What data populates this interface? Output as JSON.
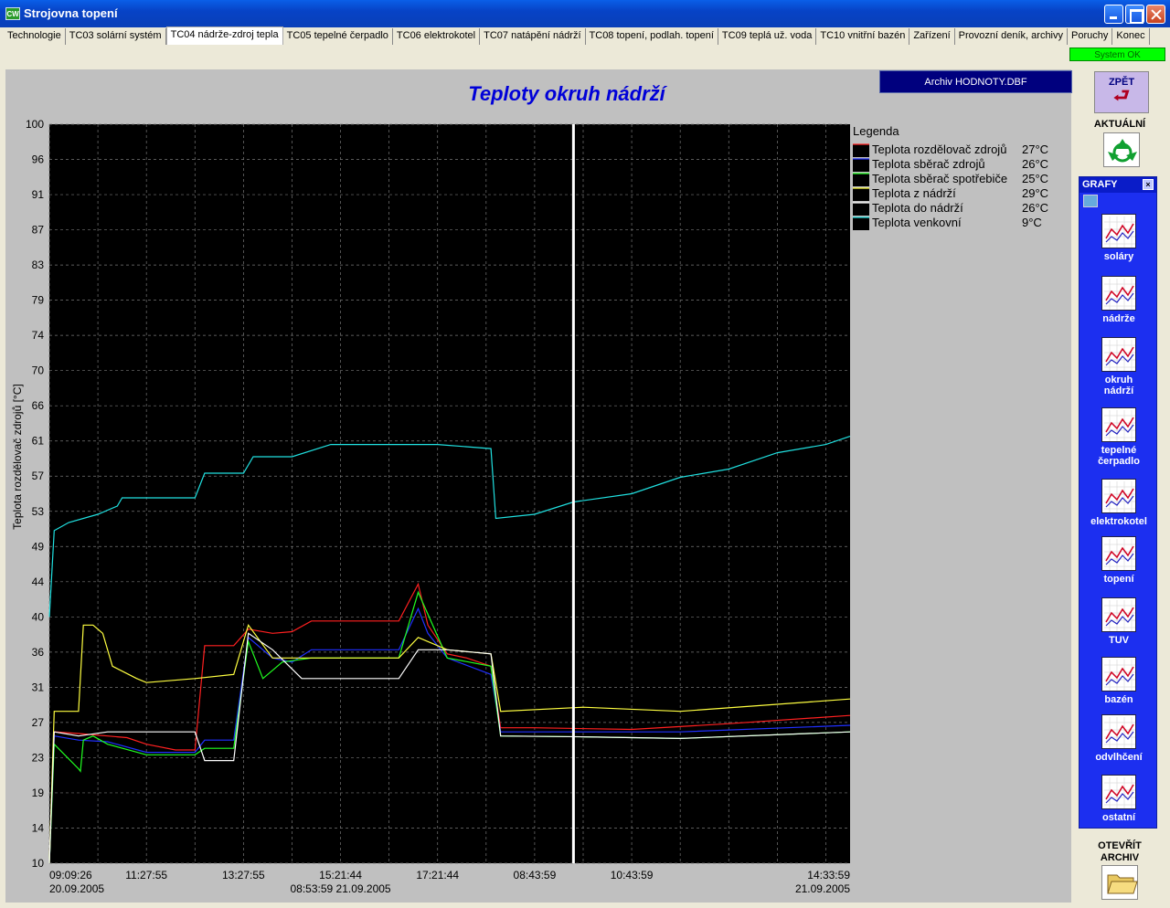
{
  "window": {
    "title": "Strojovna topení",
    "app_icon_text": "CW"
  },
  "tabs": [
    {
      "label": "Technologie",
      "active": false
    },
    {
      "label": "TC03 solární systém",
      "active": false
    },
    {
      "label": "TC04 nádrže-zdroj tepla",
      "active": true
    },
    {
      "label": "TC05 tepelné čerpadlo",
      "active": false
    },
    {
      "label": "TC06 elektrokotel",
      "active": false
    },
    {
      "label": "TC07 natápění nádrží",
      "active": false
    },
    {
      "label": "TC08 topení, podlah. topení",
      "active": false
    },
    {
      "label": "TC09 teplá už. voda",
      "active": false
    },
    {
      "label": "TC10 vnitřní bazén",
      "active": false
    },
    {
      "label": "Zařízení",
      "active": false
    },
    {
      "label": "Provozní deník, archivy",
      "active": false
    },
    {
      "label": "Poruchy",
      "active": false
    },
    {
      "label": "Konec",
      "active": false
    }
  ],
  "status": "System OK",
  "archive_label": "Archiv HODNOTY.DBF",
  "back_button": {
    "label": "ZPĚT",
    "icon": "return-arrow-icon"
  },
  "refresh": {
    "label": "AKTUÁLNÍ",
    "icon": "recycle-icon"
  },
  "graphs": {
    "title": "GRAFY",
    "items": [
      "soláry",
      "nádrže",
      "okruh nádrží",
      "tepelné čerpadlo",
      "elektrokotel",
      "topení",
      "TUV",
      "bazén",
      "odvlhčení",
      "ostatní"
    ]
  },
  "open_archive": {
    "label": "OTEVŘÍT ARCHIV",
    "icon": "folder-icon"
  },
  "colors": {
    "background": "#c0c0c0",
    "plot_bg": "#000000",
    "title": "#0000d8",
    "cursor": "#ffffff"
  },
  "chart_data": {
    "type": "line",
    "title": "Teploty okruh nádrží",
    "ylabel": "Teplota rozdělovač zdrojů [°C]",
    "ylim": [
      10,
      100
    ],
    "yticks": [
      "100",
      "96",
      "91",
      "87",
      "83",
      "79",
      "74",
      "70",
      "66",
      "61",
      "57",
      "53",
      "49",
      "44",
      "40",
      "36",
      "31",
      "27",
      "23",
      "19",
      "14",
      "10"
    ],
    "xticks": [
      {
        "t": 0,
        "line1": "09:09:26",
        "line2": "20.09.2005"
      },
      {
        "t": 1,
        "line1": "11:27:55",
        "line2": ""
      },
      {
        "t": 2,
        "line1": "13:27:55",
        "line2": ""
      },
      {
        "t": 3,
        "line1": "15:21:44",
        "line2": "08:53:59 21.09.2005"
      },
      {
        "t": 4,
        "line1": "17:21:44",
        "line2": ""
      },
      {
        "t": 5,
        "line1": "08:43:59",
        "line2": ""
      },
      {
        "t": 6,
        "line1": "10:43:59",
        "line2": ""
      },
      {
        "t": 7,
        "line1": "14:33:59",
        "line2": "21.09.2005"
      }
    ],
    "xrange": [
      0,
      8.25
    ],
    "cursor_t": 5.4,
    "grid": true,
    "legend_title": "Legenda",
    "legend_position": "top-right",
    "series": [
      {
        "name": "Teplota rozdělovač zdrojů",
        "value": "27°C",
        "color": "#ff2020",
        "t": [
          0,
          0.05,
          0.3,
          0.6,
          0.8,
          1.0,
          1.3,
          1.5,
          1.6,
          1.9,
          2.05,
          2.3,
          2.5,
          2.7,
          2.9,
          3.0,
          3.3,
          3.6,
          3.8,
          3.9,
          4.1,
          4.3,
          4.55,
          4.65,
          5.0,
          6.0,
          7.0,
          8.25
        ],
        "v": [
          10,
          26,
          25.8,
          25.5,
          25.3,
          24.5,
          23.8,
          23.8,
          36.5,
          36.5,
          38.5,
          38,
          38.2,
          39.5,
          39.5,
          39.5,
          39.5,
          39.5,
          44,
          39,
          35.5,
          35,
          34,
          26.5,
          26.5,
          26.3,
          27,
          28
        ]
      },
      {
        "name": "Teplota sběrač zdrojů",
        "value": "26°C",
        "color": "#2030ff",
        "t": [
          0,
          0.05,
          0.3,
          0.6,
          1.0,
          1.5,
          1.6,
          1.9,
          2.05,
          2.3,
          2.5,
          2.7,
          2.9,
          3.3,
          3.6,
          3.8,
          3.9,
          4.1,
          4.55,
          4.65,
          5.5,
          6.5,
          8.25
        ],
        "v": [
          10,
          25.5,
          25,
          24.8,
          23.5,
          23.5,
          25,
          25,
          37.5,
          35,
          34.5,
          36,
          36,
          36,
          36,
          41,
          38,
          35,
          33,
          26,
          26,
          26,
          26.8
        ]
      },
      {
        "name": "Teplota sběrač spotřebiče",
        "value": "25°C",
        "color": "#20ff20",
        "t": [
          0,
          0.05,
          0.3,
          0.32,
          0.35,
          0.45,
          0.6,
          1.0,
          1.5,
          1.6,
          1.9,
          2.05,
          2.2,
          2.4,
          2.7,
          3.0,
          3.6,
          3.8,
          4.1,
          4.55,
          4.65,
          5.5,
          6.5,
          8.25
        ],
        "v": [
          10,
          24.5,
          21.5,
          21.2,
          25,
          25.5,
          24.5,
          23.2,
          23.2,
          24,
          24,
          37,
          32.5,
          34.5,
          35,
          35,
          35,
          43,
          35,
          34,
          25.5,
          25.4,
          25.2,
          26
        ]
      },
      {
        "name": "Teplota z nádrží",
        "value": "29°C",
        "color": "#ffff40",
        "t": [
          0,
          0.05,
          0.3,
          0.35,
          0.45,
          0.55,
          0.65,
          0.9,
          1.0,
          1.5,
          1.9,
          2.05,
          2.3,
          2.6,
          3.0,
          3.6,
          3.8,
          4.1,
          4.55,
          4.65,
          5.5,
          6.5,
          8.25
        ],
        "v": [
          10,
          28.5,
          28.5,
          39,
          39,
          38,
          34,
          32.5,
          32,
          32.5,
          33,
          39,
          35,
          35,
          35,
          35,
          37.5,
          36,
          35.5,
          28.5,
          29,
          28.5,
          30
        ]
      },
      {
        "name": "Teplota do nádrží",
        "value": "26°C",
        "color": "#ffffff",
        "t": [
          0,
          0.05,
          0.3,
          0.6,
          1.0,
          1.5,
          1.6,
          1.9,
          2.05,
          2.3,
          2.6,
          2.8,
          3.0,
          3.6,
          3.8,
          4.1,
          4.55,
          4.65,
          5.5,
          6.5,
          8.25
        ],
        "v": [
          10,
          26,
          25.5,
          26,
          26,
          26,
          22.5,
          22.5,
          38,
          36,
          32.5,
          32.5,
          32.5,
          32.5,
          36,
          36,
          35.5,
          25.5,
          25.4,
          25.2,
          26
        ]
      },
      {
        "name": "Teplota venkovní",
        "value": "9°C",
        "color": "#20e0e0",
        "t": [
          0,
          0.05,
          0.2,
          0.5,
          0.7,
          0.75,
          1.0,
          1.5,
          1.6,
          2.0,
          2.1,
          2.5,
          2.9,
          3.0,
          3.5,
          4.0,
          4.55,
          4.6,
          5.0,
          5.4,
          6.0,
          6.5,
          7.0,
          7.5,
          8.0,
          8.25
        ],
        "v": [
          40,
          50.5,
          51.5,
          52.5,
          53.5,
          54.5,
          54.5,
          54.5,
          57.5,
          57.5,
          59.5,
          59.5,
          61,
          61,
          61,
          61,
          60.5,
          52,
          52.5,
          54,
          55,
          57,
          58,
          60,
          61,
          62
        ]
      }
    ]
  }
}
